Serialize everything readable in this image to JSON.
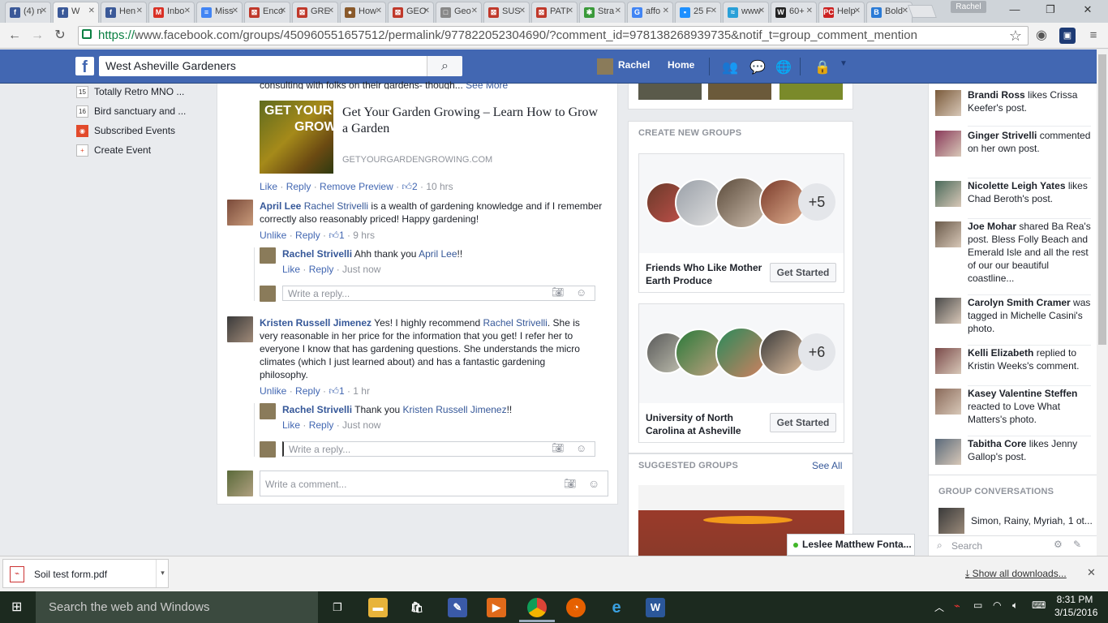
{
  "browser": {
    "tabs": [
      {
        "label": "(4) n",
        "fav": "f",
        "color": "#3b5998"
      },
      {
        "label": "W",
        "fav": "f",
        "color": "#3b5998",
        "active": true
      },
      {
        "label": "Hen",
        "fav": "f",
        "color": "#3b5998"
      },
      {
        "label": "Inbo",
        "fav": "M",
        "color": "#d93025"
      },
      {
        "label": "Miss",
        "fav": "≡",
        "color": "#4285f4"
      },
      {
        "label": "Enco",
        "fav": "⊠",
        "color": "#c0392b"
      },
      {
        "label": "GRE",
        "fav": "⊠",
        "color": "#c0392b"
      },
      {
        "label": "How",
        "fav": "●",
        "color": "#8a5a2b"
      },
      {
        "label": "GEO",
        "fav": "⊠",
        "color": "#c0392b"
      },
      {
        "label": "Geo",
        "fav": "□",
        "color": "#888888"
      },
      {
        "label": "SUS",
        "fav": "⊠",
        "color": "#c0392b"
      },
      {
        "label": "PATI",
        "fav": "⊠",
        "color": "#c0392b"
      },
      {
        "label": "Stra",
        "fav": "✱",
        "color": "#3a9a3a"
      },
      {
        "label": "affo",
        "fav": "G",
        "color": "#4285f4"
      },
      {
        "label": "25 F",
        "fav": "▪",
        "color": "#1e90ff"
      },
      {
        "label": "www",
        "fav": "≈",
        "color": "#2aa0d8"
      },
      {
        "label": "60+",
        "fav": "W",
        "color": "#222222"
      },
      {
        "label": "Help",
        "fav": "PC",
        "color": "#cc2222"
      },
      {
        "label": "Bold",
        "fav": "B",
        "color": "#2b7bd6"
      }
    ],
    "profile_badge": "Rachel",
    "url_scheme": "https://",
    "url_rest": "www.facebook.com/groups/450960551657512/permalink/977822052304690/?comment_id=978138268939735&notif_t=group_comment_mention"
  },
  "fb": {
    "search_value": "West Asheville Gardeners",
    "user_name": "Rachel",
    "home_label": "Home"
  },
  "sidebar": {
    "items": [
      {
        "icon": "15",
        "label": "Totally Retro MNO ..."
      },
      {
        "icon": "16",
        "label": "Bird sanctuary and ..."
      },
      {
        "icon": "rss",
        "label": "Subscribed Events"
      },
      {
        "icon": "+",
        "label": "Create Event"
      }
    ]
  },
  "post": {
    "truncated_text": "consulting with folks on their gardens- though...",
    "see_more": "See More",
    "preview": {
      "image_text_1": "GET YOUR",
      "image_text_2": "GROW",
      "title": "Get Your Garden Growing – Learn How to Grow a Garden",
      "domain": "GETYOURGARDENGROWING.COM"
    },
    "actions": {
      "like": "Like",
      "reply": "Reply",
      "remove_preview": "Remove Preview",
      "likes": "2",
      "time": "10 hrs"
    }
  },
  "comments": [
    {
      "author": "April Lee",
      "mention": "Rachel Strivelli",
      "text": " is a wealth of gardening knowledge and if I remember correctly also reasonably priced! Happy gardening!",
      "unlike": "Unlike",
      "reply": "Reply",
      "likes": "1",
      "time": "9 hrs",
      "reply_item": {
        "author": "Rachel Strivelli",
        "text": "Ahh thank you ",
        "mention": "April Lee",
        "tail": "!!",
        "like": "Like",
        "reply": "Reply",
        "time": "Just now"
      },
      "reply_placeholder": "Write a reply..."
    },
    {
      "author": "Kristen Russell Jimenez",
      "pre": " Yes! I highly recommend ",
      "mention": "Rachel Strivelli",
      "text": ". She is very reasonable in her price for the information that you get! I refer her to everyone I know that has gardening questions. She understands the micro climates (which I just learned about) and has a fantastic gardening philosophy.",
      "unlike": "Unlike",
      "reply": "Reply",
      "likes": "1",
      "time": "1 hr",
      "reply_item": {
        "author": "Rachel Strivelli",
        "text": "Thank you ",
        "mention": "Kristen Russell Jimenez",
        "tail": "!!",
        "like": "Like",
        "reply": "Reply",
        "time": "Just now"
      },
      "reply_placeholder": "Write a reply..."
    }
  ],
  "comment_placeholder": "Write a comment...",
  "create_groups": {
    "title": "CREATE NEW GROUPS",
    "cards": [
      {
        "name": "Friends Who Like Mother Earth Produce",
        "more": "+5",
        "button": "Get Started"
      },
      {
        "name": "University of North Carolina at Asheville",
        "more": "+6",
        "button": "Get Started"
      }
    ]
  },
  "suggested": {
    "title": "SUGGESTED GROUPS",
    "see_all": "See All"
  },
  "chat_tab": "Leslee Matthew Fonta...",
  "ticker": [
    {
      "name": "Brandi Ross",
      "text": " likes Crissa Keefer's post."
    },
    {
      "name": "Ginger Strivelli",
      "text": " commented on her own post."
    },
    {
      "name": "Nicolette Leigh Yates",
      "text": " likes Chad Beroth's post."
    },
    {
      "name": "Joe Mohar",
      "text": " shared Ba Rea's post. Bless Folly Beach and Emerald Isle and all the rest of our our beautiful coastline..."
    },
    {
      "name": "Carolyn Smith Cramer",
      "text": " was tagged in Michelle Casini's photo."
    },
    {
      "name": "Kelli Elizabeth",
      "text": " replied to Kristin Weeks's comment."
    },
    {
      "name": "Kasey Valentine Steffen",
      "text": " reacted to Love What Matters's photo."
    },
    {
      "name": "Tabitha Core",
      "text": " likes Jenny Gallop's post."
    }
  ],
  "group_conversations": {
    "title": "GROUP CONVERSATIONS",
    "item": "Simon, Rainy, Myriah, 1 ot..."
  },
  "chat_search_placeholder": "Search",
  "downloads": {
    "file": "Soil test form.pdf",
    "show_all": "Show all downloads..."
  },
  "taskbar": {
    "search": "Search the web and Windows",
    "time": "8:31 PM",
    "date": "3/15/2016"
  }
}
